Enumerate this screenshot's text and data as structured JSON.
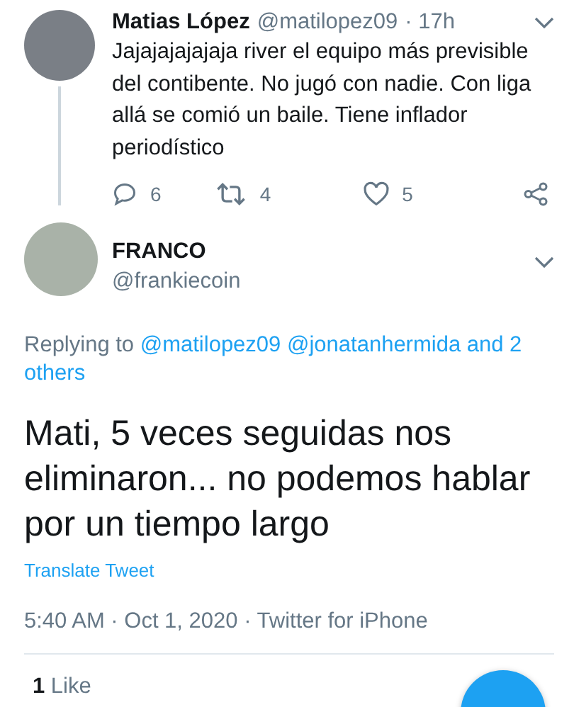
{
  "parent_tweet": {
    "name": "Matias López",
    "handle": "@matilopez09",
    "time": "· 17h",
    "text": "Jajajajajajaja river el equipo más previsible del contibente. No jugó con nadie. Con liga allá se comió un baile. Tiene inflador periodístico",
    "actions": [
      {
        "kind": "reply",
        "count": "6"
      },
      {
        "kind": "retweet",
        "count": "4"
      },
      {
        "kind": "like",
        "count": "5"
      },
      {
        "kind": "share"
      }
    ]
  },
  "tweet": {
    "name": "FRANCO",
    "handle": "@frankiecoin",
    "replying_label": "Replying to",
    "replying_to": [
      "@matilopez09",
      "@jonatanhermida",
      "and 2",
      "others"
    ],
    "text": "Mati, 5 veces seguidas nos eliminaron... no podemos hablar por un tiempo largo",
    "translate": "Translate Tweet",
    "timestamp": "5:40 AM · Oct 1, 2020 · Twitter for iPhone",
    "likes": "**1** Like"
  }
}
